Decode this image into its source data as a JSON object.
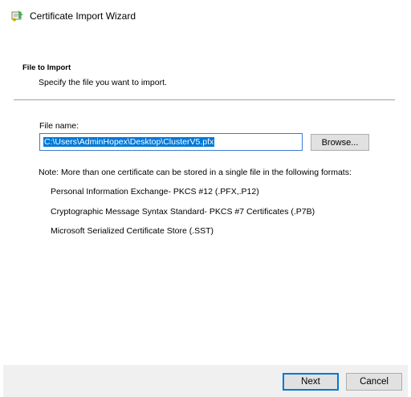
{
  "window": {
    "title": "Certificate Import Wizard",
    "icon": "certificate-wizard-icon"
  },
  "section": {
    "heading": "File to Import",
    "subtitle": "Specify the file you want to import."
  },
  "file": {
    "label": "File name:",
    "value": "C:\\Users\\AdminHopex\\Desktop\\ClusterV5.pfx",
    "browse_label": "Browse..."
  },
  "note": "Note:  More than one certificate can be stored in a single file in the following formats:",
  "formats": [
    "Personal Information Exchange- PKCS #12 (.PFX,.P12)",
    "Cryptographic Message Syntax Standard- PKCS #7 Certificates (.P7B)",
    "Microsoft Serialized Certificate Store (.SST)"
  ],
  "footer": {
    "next_label": "Next",
    "cancel_label": "Cancel"
  },
  "colors": {
    "selection": "#0078d7",
    "footer_bg": "#f0f0f0",
    "button_bg": "#e1e1e1"
  }
}
